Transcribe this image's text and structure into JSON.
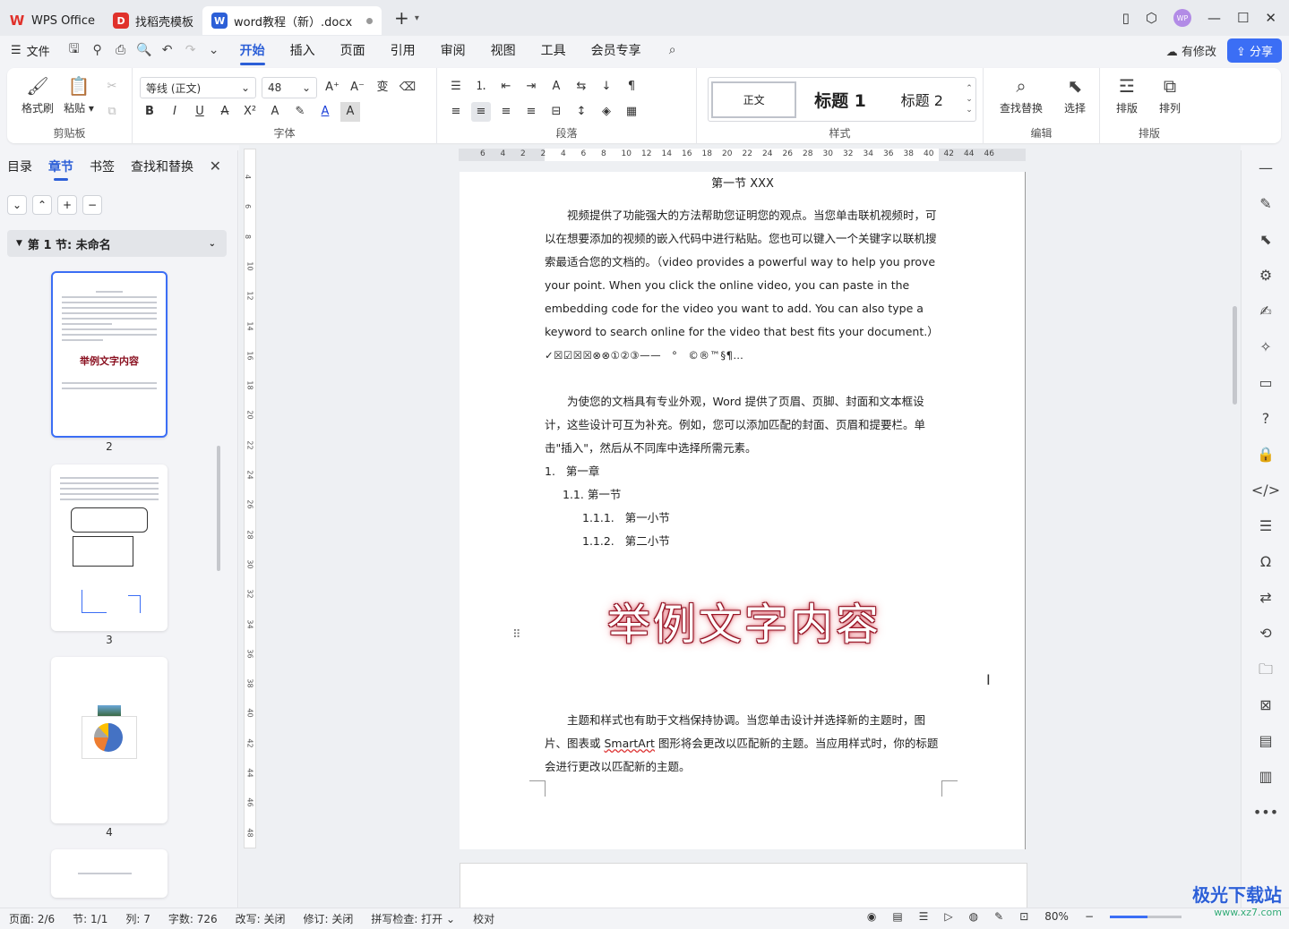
{
  "tabs": [
    {
      "label": "WPS Office",
      "icon": "wps-logo-icon"
    },
    {
      "label": "找稻壳模板",
      "icon": "docer-logo-icon"
    },
    {
      "label": "word教程（新）.docx",
      "icon": "word-doc-icon"
    }
  ],
  "menubar": {
    "file_label": "文件",
    "items": [
      "开始",
      "插入",
      "页面",
      "引用",
      "审阅",
      "视图",
      "工具",
      "会员专享"
    ],
    "active": "开始",
    "modified_label": "有修改",
    "share_label": "分享"
  },
  "ribbon": {
    "clipboard": {
      "format_painter": "格式刷",
      "paste": "粘贴",
      "label": "剪贴板"
    },
    "font": {
      "font_name": "等线 (正文)",
      "font_size": "48",
      "label": "字体"
    },
    "paragraph": {
      "label": "段落"
    },
    "styles": {
      "normal": "正文",
      "heading1": "标题 1",
      "heading2": "标题 2",
      "label": "样式"
    },
    "edit": {
      "find_replace": "查找替换",
      "select": "选择",
      "label": "编辑"
    },
    "arrange": {
      "layout": "排版",
      "arrange": "排列",
      "label": "排版"
    }
  },
  "leftpanel": {
    "tabs": [
      "目录",
      "章节",
      "书签",
      "查找和替换"
    ],
    "active": "章节",
    "section_title": "第 1 节: 未命名",
    "thumb_title": "举例文字内容",
    "page_numbers": [
      "2",
      "3",
      "4"
    ]
  },
  "ruler": {
    "h": [
      "6",
      "4",
      "2",
      "2",
      "4",
      "6",
      "8",
      "10",
      "12",
      "14",
      "16",
      "18",
      "20",
      "22",
      "24",
      "26",
      "28",
      "30",
      "32",
      "34",
      "36",
      "38",
      "40",
      "42",
      "44",
      "46"
    ],
    "v": [
      "4",
      "6",
      "8",
      "10",
      "12",
      "14",
      "16",
      "18",
      "20",
      "22",
      "24",
      "26",
      "28",
      "30",
      "32",
      "34",
      "36",
      "38",
      "40",
      "42",
      "44",
      "46",
      "48"
    ]
  },
  "document": {
    "section_heading": "第一节 XXX",
    "para1": "视频提供了功能强大的方法帮助您证明您的观点。当您单击联机视频时，可以在想要添加的视频的嵌入代码中进行粘贴。您也可以键入一个关键字以联机搜索最适合您的文档的。（video provides a powerful way to help you prove your point. When you click the online video, you can paste in the embedding code for the video you want to add. You can also type a keyword to search online for the video that best fits your document.）",
    "symbols": "✓☒☑☒☒⊗⊗①②③——　°　©®™§¶…",
    "para2": "为使您的文档具有专业外观，Word 提供了页眉、页脚、封面和文本框设计，这些设计可互为补充。例如，您可以添加匹配的封面、页眉和提要栏。单击\"插入\"，然后从不同库中选择所需元素。",
    "list": [
      {
        "num": "1.",
        "text": "第一章"
      },
      {
        "num": "1.1.",
        "text": "第一节"
      },
      {
        "num": "1.1.1.",
        "text": "第一小节"
      },
      {
        "num": "1.1.2.",
        "text": "第二小节"
      }
    ],
    "art_text": "举例文字内容",
    "para3_a": "主题和样式也有助于文档保持协调。当您单击设计并选择新的主题时，图片、图表或 ",
    "para3_smartart": "SmartArt",
    "para3_b": " 图形将会更改以匹配新的主题。当应用样式时，你的标题会进行更改以匹配新的主题。"
  },
  "statusbar": {
    "page": "页面: 2/6",
    "section": "节: 1/1",
    "column": "列: 7",
    "words": "字数: 726",
    "overtype": "改写: 关闭",
    "revision": "修订: 关闭",
    "spellcheck": "拼写检查: 打开",
    "proof": "校对",
    "zoom": "80%"
  },
  "watermark": {
    "title": "极光下载站",
    "url": "www.xz7.com"
  },
  "colors": {
    "accent": "#2c5fd7",
    "share": "#3b6ef5",
    "art_text_glow": "#c0283a"
  }
}
